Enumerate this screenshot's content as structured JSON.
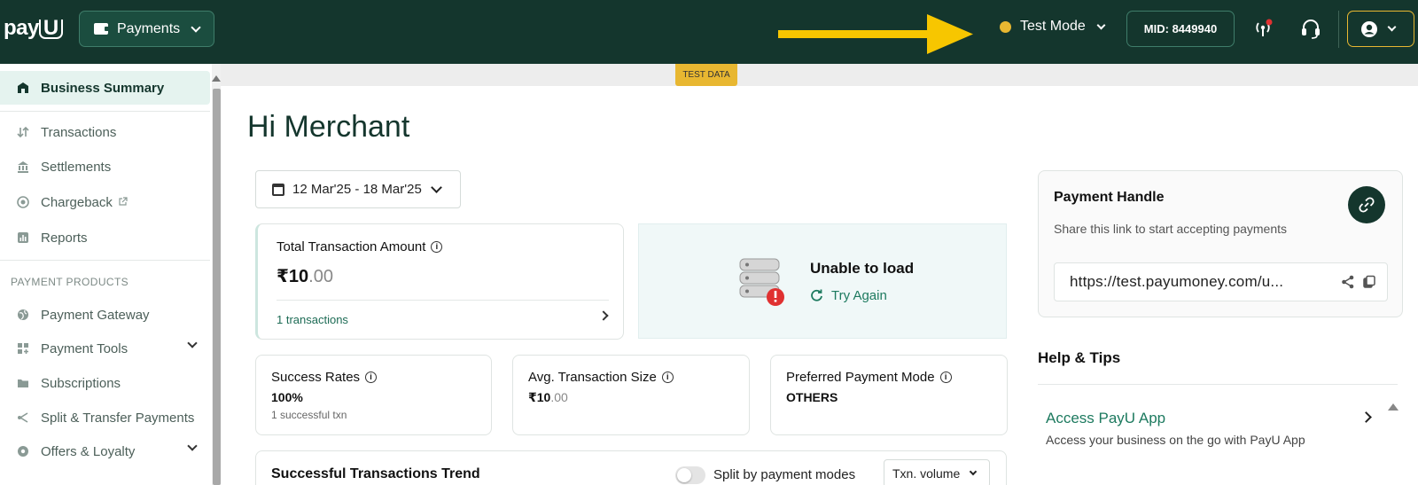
{
  "topbar": {
    "logo_text_a": "pay",
    "logo_text_b": "U",
    "product_button": "Payments",
    "mode_label": "Test Mode",
    "mid_label": "MID: 8449940",
    "colors": {
      "background": "#14362d",
      "accent": "#e8b731",
      "arrow": "#f7c600"
    }
  },
  "sidebar": {
    "items": [
      {
        "label": "Business Summary",
        "icon": "business-icon"
      },
      {
        "label": "Transactions",
        "icon": "transactions-icon"
      },
      {
        "label": "Settlements",
        "icon": "bank-icon"
      },
      {
        "label": "Chargeback",
        "icon": "chargeback-icon"
      },
      {
        "label": "Reports",
        "icon": "reports-icon"
      }
    ],
    "section_heading": "PAYMENT PRODUCTS",
    "products": [
      {
        "label": "Payment Gateway",
        "icon": "globe-icon"
      },
      {
        "label": "Payment Tools",
        "icon": "grid-icon"
      },
      {
        "label": "Subscriptions",
        "icon": "folder-icon"
      },
      {
        "label": "Split & Transfer Payments",
        "icon": "split-icon"
      },
      {
        "label": "Offers & Loyalty",
        "icon": "gear-badge-icon"
      }
    ]
  },
  "banner": {
    "badge": "TEST DATA"
  },
  "main": {
    "greeting": "Hi Merchant",
    "date_range": "12 Mar'25 - 18 Mar'25",
    "total_card": {
      "title": "Total Transaction Amount",
      "amount_main": "₹10",
      "amount_dec": ".00",
      "link": "1 transactions"
    },
    "error_card": {
      "message": "Unable to load",
      "retry": "Try Again"
    },
    "stats": [
      {
        "title": "Success Rates",
        "value": "100%",
        "sub": "1 successful txn"
      },
      {
        "title": "Avg. Transaction Size",
        "value_main": "₹10",
        "value_dec": ".00"
      },
      {
        "title": "Preferred Payment Mode",
        "value": "OTHERS"
      }
    ],
    "trend": {
      "title": "Successful Transactions Trend",
      "toggle_label": "Split by payment modes",
      "select_value": "Txn. volume"
    }
  },
  "right": {
    "handle": {
      "title": "Payment Handle",
      "desc": "Share this link to start accepting payments",
      "url": "https://test.payumoney.com/u..."
    },
    "help": {
      "title": "Help & Tips",
      "tip_title": "Access PayU App",
      "tip_desc": "Access your business on the go with PayU App"
    }
  }
}
